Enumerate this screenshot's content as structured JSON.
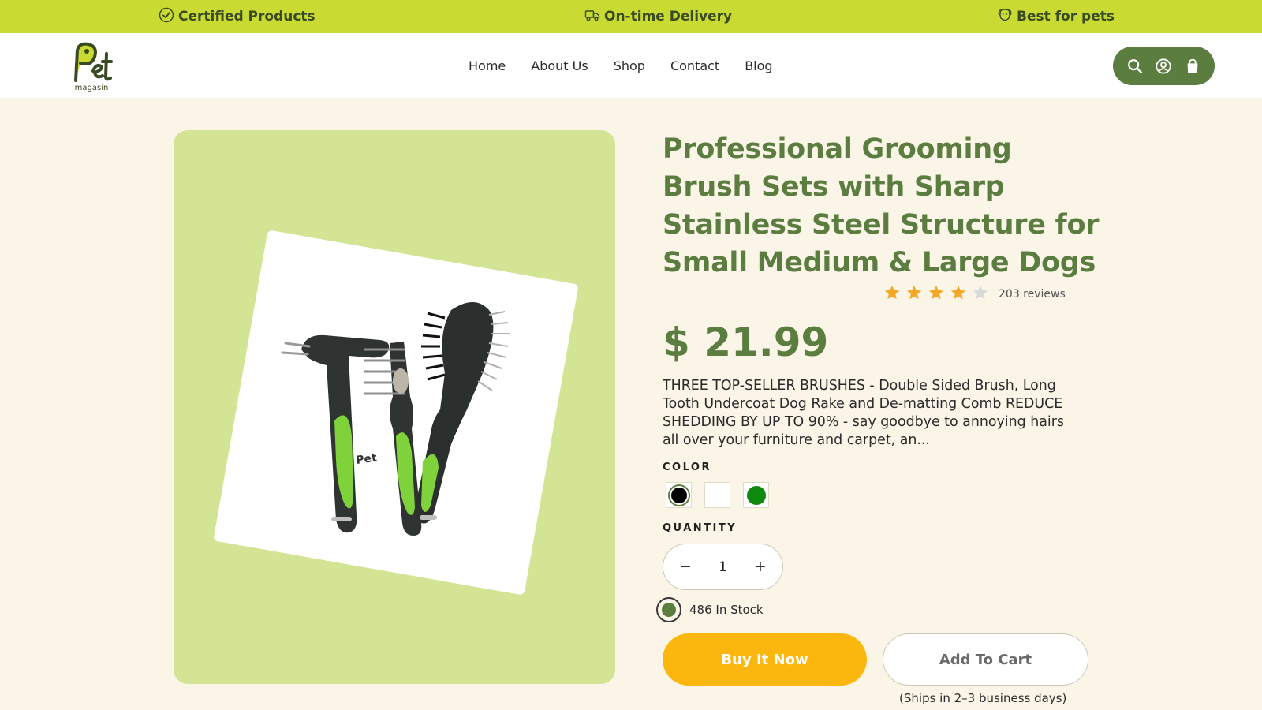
{
  "topbar": {
    "items": [
      {
        "icon": "check-circle-icon",
        "label": "Certified Products"
      },
      {
        "icon": "delivery-truck-icon",
        "label": "On-time Delivery"
      },
      {
        "icon": "dog-face-icon",
        "label": "Best for pets"
      }
    ],
    "background": "#c9da32"
  },
  "header": {
    "logo": {
      "text": "Pet",
      "subtext": "magasin"
    },
    "nav": [
      "Home",
      "About Us",
      "Shop",
      "Contact",
      "Blog"
    ],
    "actions": [
      "search-icon",
      "account-icon",
      "shopping-bag-icon"
    ],
    "actions_background": "#5b7d40"
  },
  "product": {
    "title": "Professional Grooming Brush Sets with Sharp Stainless Steel Structure for Small Medium & Large Dogs",
    "rating": 4,
    "rating_max": 5,
    "reviews": "203 reviews",
    "price": "$ 21.99",
    "description": "THREE TOP-SELLER BRUSHES - Double Sided Brush, Long Tooth Undercoat Dog Rake and De-matting Comb REDUCE SHEDDING BY UP TO 90% - say goodbye to annoying hairs all over your furniture and carpet, an...",
    "color_label": "COLOR",
    "colors": [
      {
        "name": "black",
        "hex": "#000000",
        "selected": true
      },
      {
        "name": "white",
        "hex": "#ffffff",
        "selected": false
      },
      {
        "name": "green",
        "hex": "#0e8a0e",
        "selected": false
      }
    ],
    "quantity_label": "QUANTITY",
    "quantity": {
      "minus": "−",
      "value": "1",
      "plus": "+"
    },
    "stock": "486 In Stock",
    "buy_now": "Buy It Now",
    "add_to_cart": "Add To Cart",
    "shipping_note": "(Ships in 2–3 business days)"
  },
  "colors": {
    "brand_green": "#5b7d40",
    "accent_yellow": "#fbb70e",
    "page_background": "#fbf5e8",
    "gallery_background": "#d3e594",
    "star_filled": "#f5a623",
    "star_empty": "#d9d9d9"
  }
}
